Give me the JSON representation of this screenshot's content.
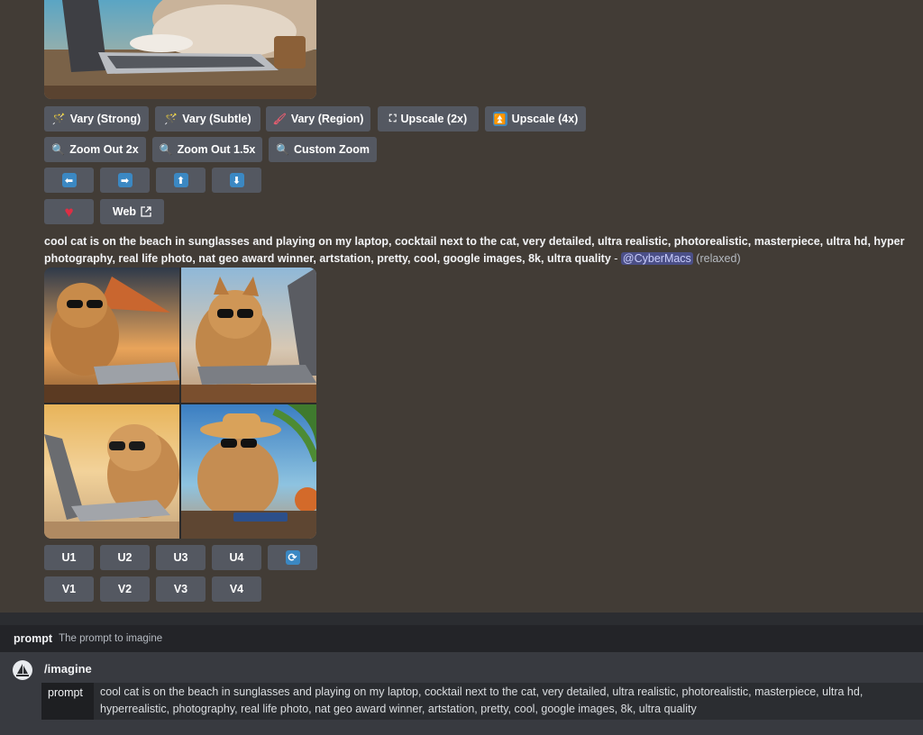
{
  "buttons_row1": [
    {
      "icon": "magic-wand-icon",
      "label": "Vary (Strong)"
    },
    {
      "icon": "magic-wand-icon",
      "label": "Vary (Subtle)"
    },
    {
      "icon": "paintbrush-icon",
      "label": "Vary (Region)"
    },
    {
      "icon": "expand-icon",
      "label": "Upscale (2x)"
    },
    {
      "icon": "up-arrow-box-icon",
      "label": "Upscale (4x)"
    }
  ],
  "buttons_row2": [
    {
      "icon": "magnifier-icon",
      "label": "Zoom Out 2x"
    },
    {
      "icon": "magnifier-icon",
      "label": "Zoom Out 1.5x"
    },
    {
      "icon": "magnifier-icon",
      "label": "Custom Zoom"
    }
  ],
  "pan_buttons": [
    "⬅",
    "➡",
    "⬆",
    "⬇"
  ],
  "web_button": "Web",
  "message": {
    "prompt_line1": "cool cat is on the beach in sunglasses and playing on my laptop, cocktail next to the cat, very detailed, ultra realistic, photorealistic, masterpiece, ultra hd, hyper",
    "prompt_line2": "photography, real life photo, nat geo award winner, artstation, pretty, cool, google images, 8k, ultra quality",
    "separator": " - ",
    "mention": "@CyberMacs",
    "mode": "(relaxed)"
  },
  "upscale_buttons": [
    "U1",
    "U2",
    "U3",
    "U4"
  ],
  "variation_buttons": [
    "V1",
    "V2",
    "V3",
    "V4"
  ],
  "command": {
    "hint_name": "prompt",
    "hint_desc": "The prompt to imagine",
    "command_name": "/imagine",
    "param_label": "prompt",
    "param_value_line1": "cool cat is on the beach in sunglasses and playing on my laptop, cocktail next to the cat, very detailed, ultra realistic, photorealistic, masterpiece, ultra hd,",
    "param_value_line2": "hyperrealistic, photography, real life photo, nat geo award winner, artstation, pretty, cool, google images, 8k, ultra quality"
  },
  "colors": {
    "background": "#423c36",
    "button": "#545861",
    "accent_blue": "#3b88c3",
    "heart": "#dd2e44"
  }
}
